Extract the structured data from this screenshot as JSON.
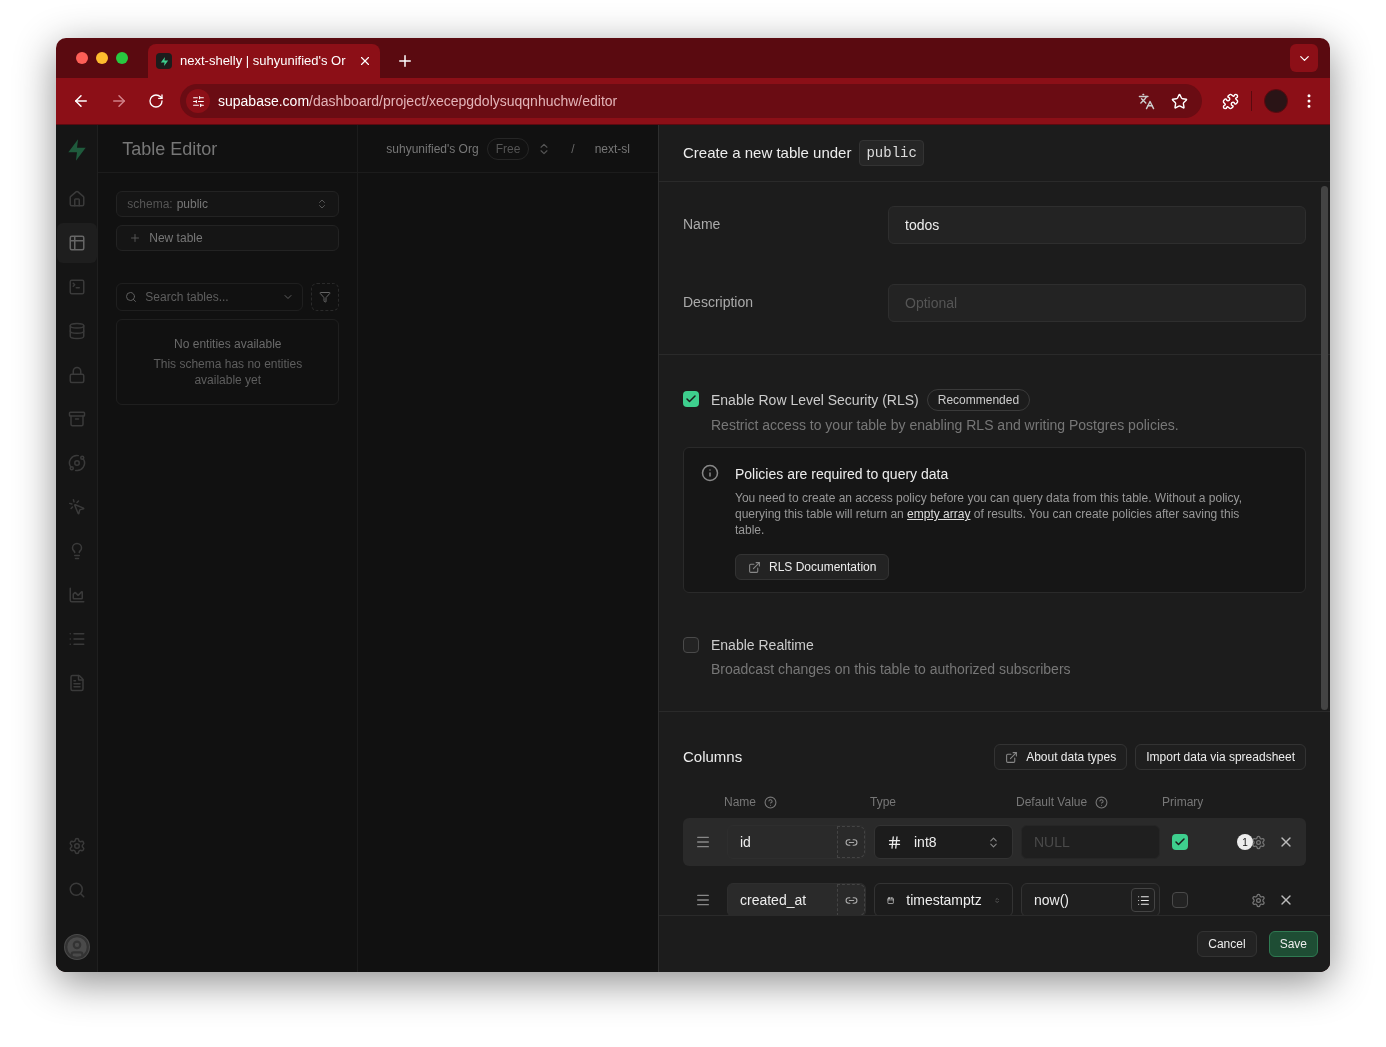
{
  "browser": {
    "tab_title": "next-shelly | suhyunified's Or",
    "url_host": "supabase.com",
    "url_path": "/dashboard/project/xecepgdolysuqqnhuchw/editor"
  },
  "background": {
    "app_title": "Table Editor",
    "org": "suhyunified's Org",
    "plan": "Free",
    "separator": "/",
    "project": "next-sl",
    "schema_label": "schema:",
    "schema_value": "public",
    "new_table": "New table",
    "search_placeholder": "Search tables...",
    "empty_title": "No entities available",
    "empty_text": "This schema has no entities available yet",
    "sidebar": [
      {
        "kind": "home",
        "selected": false
      },
      {
        "kind": "table",
        "selected": true
      },
      {
        "kind": "sql",
        "selected": false
      },
      {
        "kind": "database",
        "selected": false
      },
      {
        "kind": "auth",
        "selected": false
      },
      {
        "kind": "storage",
        "selected": false
      },
      {
        "kind": "realtime",
        "selected": false
      },
      {
        "kind": "functions",
        "selected": false
      },
      {
        "kind": "advisors",
        "selected": false
      },
      {
        "kind": "reports",
        "selected": false
      },
      {
        "kind": "logs",
        "selected": false
      },
      {
        "kind": "docs",
        "selected": false
      },
      {
        "kind": "settings",
        "selected": false
      },
      {
        "kind": "search",
        "selected": false
      }
    ]
  },
  "sheet": {
    "title": "Create a new table under",
    "schema": "public",
    "fields": [
      {
        "label": "Name",
        "value": "todos"
      },
      {
        "label": "Description",
        "placeholder": "Optional"
      }
    ],
    "rls": {
      "checked": true,
      "label": "Enable Row Level Security (RLS)",
      "badge": "Recommended",
      "description": "Restrict access to your table by enabling RLS and writing Postgres policies."
    },
    "notice": {
      "title": "Policies are required to query data",
      "text_before": "You need to create an access policy before you can query data from this table. Without a policy, querying this table will return an",
      "link": "empty array",
      "text_after": "of results. You can create policies after saving this table.",
      "button": "RLS Documentation"
    },
    "realtime": {
      "checked": false,
      "label": "Enable Realtime",
      "description": "Broadcast changes on this table to authorized subscribers"
    },
    "columns": {
      "title": "Columns",
      "buttons": [
        {
          "label": "About data types",
          "kind": "link"
        },
        {
          "label": "Import data via spreadsheet",
          "kind": "plain"
        }
      ],
      "headers": [
        {
          "label": "Name",
          "help": true
        },
        {
          "label": "Type",
          "help": false
        },
        {
          "label": "Default Value",
          "help": true
        },
        {
          "label": "Primary",
          "help": false
        }
      ],
      "rows": [
        {
          "name": "id",
          "type": "int8",
          "kind": "number",
          "default_placeholder": "NULL",
          "primary": true,
          "badge": "1",
          "selected": true
        },
        {
          "name": "created_at",
          "type": "timestamptz",
          "kind": "date",
          "default": "now()",
          "primary": false,
          "selected": false
        }
      ]
    },
    "footer": {
      "cancel": "Cancel",
      "save": "Save"
    }
  }
}
